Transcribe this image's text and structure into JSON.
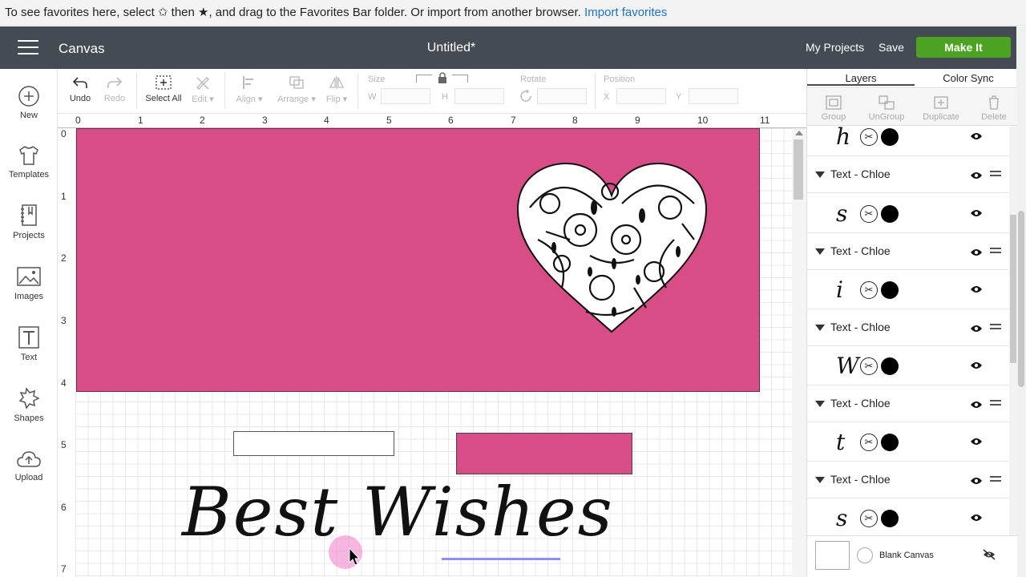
{
  "favorites_bar": {
    "message": "To see favorites here, select ✩ then ★, and drag to the Favorites Bar folder. Or import from another browser.",
    "import_link": "Import favorites"
  },
  "header": {
    "brand": "Canvas",
    "title": "Untitled*",
    "my_projects": "My Projects",
    "save": "Save",
    "make_it": "Make It"
  },
  "sidebar": {
    "items": [
      {
        "label": "New",
        "icon": "plus-circle-icon"
      },
      {
        "label": "Templates",
        "icon": "shirt-icon"
      },
      {
        "label": "Projects",
        "icon": "notebook-icon"
      },
      {
        "label": "Images",
        "icon": "image-icon"
      },
      {
        "label": "Text",
        "icon": "text-icon"
      },
      {
        "label": "Shapes",
        "icon": "shapes-icon"
      },
      {
        "label": "Upload",
        "icon": "cloud-upload-icon"
      }
    ]
  },
  "toolbar": {
    "undo": "Undo",
    "redo": "Redo",
    "select_all": "Select All",
    "edit": "Edit",
    "align": "Align",
    "arrange": "Arrange",
    "flip": "Flip",
    "size": "Size",
    "w": "W",
    "h": "H",
    "rotate": "Rotate",
    "position": "Position",
    "x": "X",
    "y": "Y"
  },
  "ruler": {
    "top": [
      "0",
      "1",
      "2",
      "3",
      "4",
      "5",
      "6",
      "7",
      "8",
      "9",
      "10",
      "11"
    ],
    "left": [
      "0",
      "1",
      "2",
      "3",
      "4",
      "5",
      "6",
      "7"
    ]
  },
  "canvas": {
    "text": "Best Wishes"
  },
  "panel": {
    "tabs": [
      "Layers",
      "Color Sync"
    ],
    "tools": [
      "Group",
      "UnGroup",
      "Duplicate",
      "Delete"
    ],
    "layers": [
      {
        "type": "child",
        "glyph": "h"
      },
      {
        "type": "group",
        "name": "Text - Chloe"
      },
      {
        "type": "child",
        "glyph": "s"
      },
      {
        "type": "group",
        "name": "Text - Chloe"
      },
      {
        "type": "child",
        "glyph": "i"
      },
      {
        "type": "group",
        "name": "Text - Chloe"
      },
      {
        "type": "child",
        "glyph": "W"
      },
      {
        "type": "group",
        "name": "Text - Chloe"
      },
      {
        "type": "child",
        "glyph": "t"
      },
      {
        "type": "group",
        "name": "Text - Chloe"
      },
      {
        "type": "child",
        "glyph": "s"
      }
    ],
    "blank_canvas": "Blank Canvas"
  },
  "colors": {
    "card": "#d94d87",
    "header": "#444b53",
    "make_it": "#4ca321"
  }
}
